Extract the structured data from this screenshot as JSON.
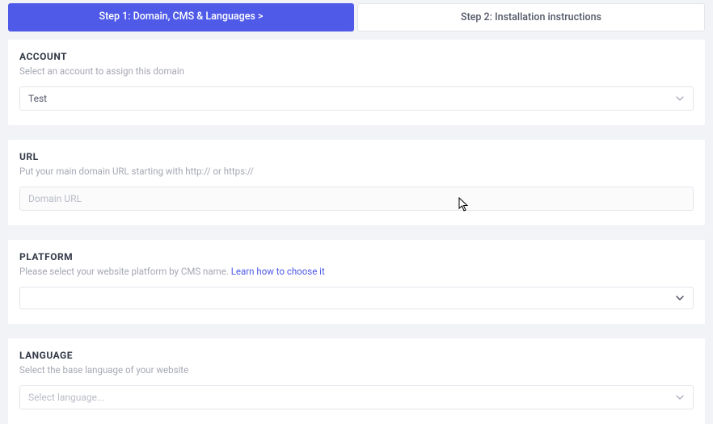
{
  "tabs": {
    "step1": "Step 1: Domain, CMS & Languages  >",
    "step2": "Step 2: Installation instructions"
  },
  "account": {
    "title": "ACCOUNT",
    "desc": "Select an account to assign this domain",
    "value": "Test"
  },
  "url": {
    "title": "URL",
    "desc": "Put your main domain URL starting with http:// or https://",
    "placeholder": "Domain URL"
  },
  "platform": {
    "title": "PLATFORM",
    "desc": "Please select your website platform by CMS name.  ",
    "link": "Learn how to choose it",
    "value": ""
  },
  "language": {
    "title": "LANGUAGE",
    "desc": "Select the base language of your website",
    "value": "Select language..."
  }
}
